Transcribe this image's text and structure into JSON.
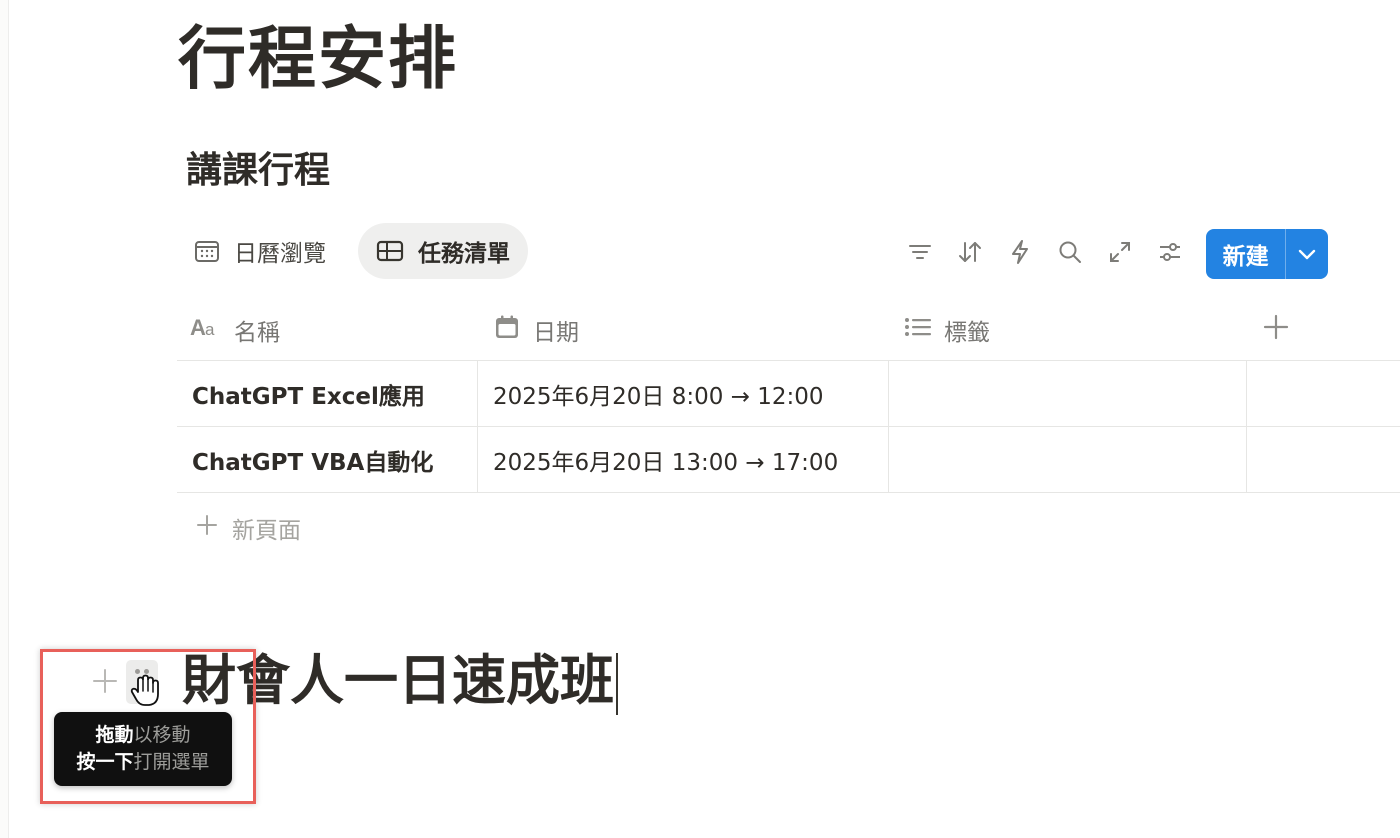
{
  "page": {
    "title": "行程安排"
  },
  "database": {
    "title": "講課行程",
    "views": [
      {
        "label": "日曆瀏覽",
        "icon": "calendar-icon"
      },
      {
        "label": "任務清單",
        "icon": "table-icon",
        "active": true
      }
    ],
    "toolbar": {
      "icons": [
        "filter-icon",
        "sort-icon",
        "automation-icon",
        "search-icon",
        "expand-icon",
        "settings-icon"
      ],
      "new_button_label": "新建"
    },
    "columns": [
      {
        "label": "名稱",
        "icon": "text-type-icon"
      },
      {
        "label": "日期",
        "icon": "calendar-icon"
      },
      {
        "label": "標籤",
        "icon": "list-icon"
      }
    ],
    "rows": [
      {
        "name": "ChatGPT Excel應用",
        "date": "2025年6月20日 8:00 → 12:00",
        "tags": ""
      },
      {
        "name": "ChatGPT VBA自動化",
        "date": "2025年6月20日 13:00 → 17:00",
        "tags": ""
      }
    ],
    "new_page_label": "新頁面"
  },
  "heading_block": {
    "text": "財會人一日速成班"
  },
  "tooltip": {
    "line1_strong": "拖動",
    "line1_rest": "以移動",
    "line2_strong": "按一下",
    "line2_rest": "打開選單"
  },
  "colors": {
    "accent": "#2383e2",
    "highlight_border": "#e8605a",
    "tooltip_bg": "#101010"
  }
}
